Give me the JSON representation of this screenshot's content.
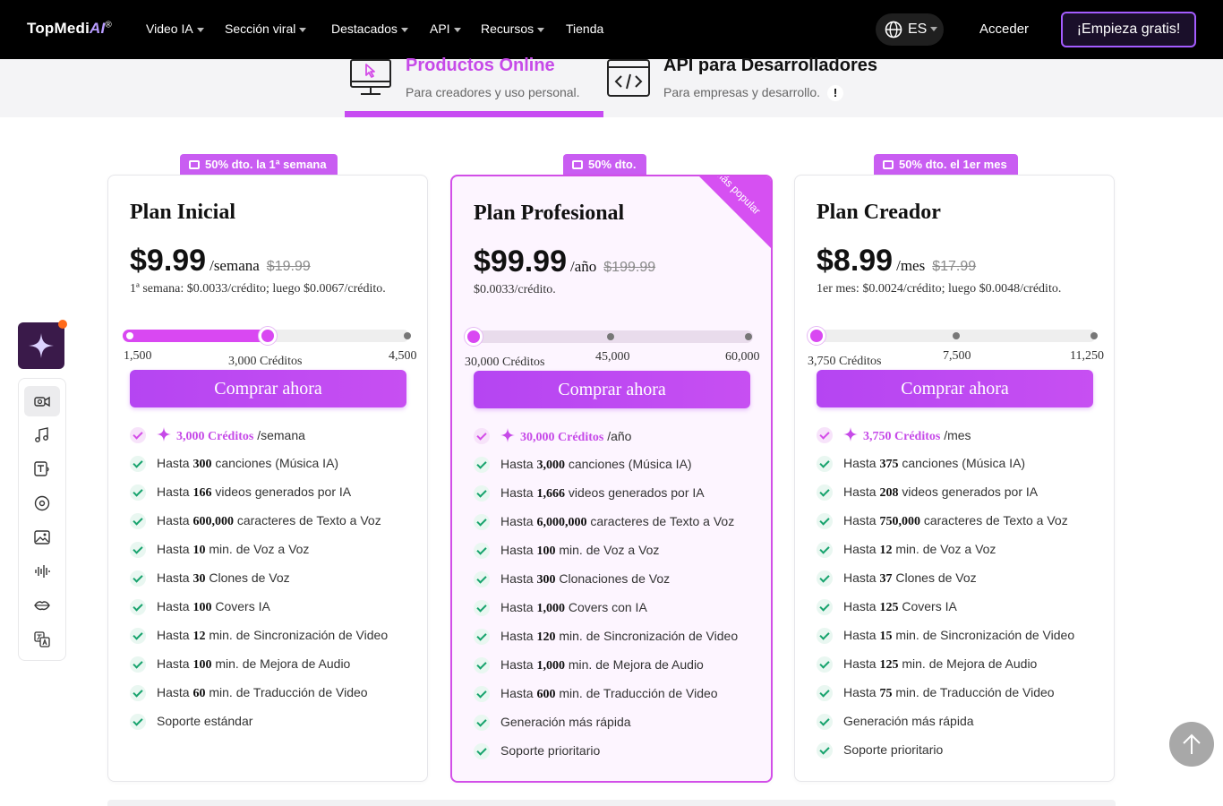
{
  "nav": {
    "logo_top": "TopMedi",
    "logo_ai": "AI",
    "logo_reg": "®",
    "items": [
      {
        "label": "Video IA"
      },
      {
        "label": "Sección viral"
      },
      {
        "label": "Destacados"
      },
      {
        "label": "API"
      },
      {
        "label": "Recursos"
      },
      {
        "label": "Tienda"
      }
    ],
    "lang": "ES",
    "login": "Acceder",
    "cta": "¡Empieza gratis!"
  },
  "product_tabs": [
    {
      "title": "Productos Online",
      "subtitle": "Para creadores y uso personal."
    },
    {
      "title": "API para Desarrolladores",
      "subtitle": "Para empresas y desarrollo.",
      "badge": "!"
    }
  ],
  "colors": {
    "accent": "#c74bf2",
    "check": "#17a36d"
  },
  "plans": [
    {
      "badge": "50% dto. la 1ª semana",
      "name": "Plan Inicial",
      "price": "$9.99",
      "period": "/semana",
      "old_price": "$19.99",
      "note": "1ª semana: $0.0033/crédito; luego $0.0067/crédito.",
      "slider": {
        "min": "1,500",
        "selected": "3,000 Créditos",
        "max": "4,500",
        "position": 0.5
      },
      "buy": "Comprar ahora",
      "credits": {
        "amount": "3,000 Créditos",
        "per": "/semana"
      },
      "features": [
        {
          "pre": "Hasta ",
          "num": "300",
          "post": " canciones (Música IA)"
        },
        {
          "pre": "Hasta ",
          "num": "166",
          "post": " videos generados por IA"
        },
        {
          "pre": "Hasta ",
          "num": "600,000",
          "post": " caracteres de Texto a Voz"
        },
        {
          "pre": "Hasta ",
          "num": "10",
          "post": " min. de Voz a Voz"
        },
        {
          "pre": "Hasta ",
          "num": "30",
          "post": " Clones de Voz"
        },
        {
          "pre": "Hasta ",
          "num": "100",
          "post": " Covers IA"
        },
        {
          "pre": "Hasta ",
          "num": "12",
          "post": " min. de Sincronización de Video"
        },
        {
          "pre": "Hasta ",
          "num": "100",
          "post": " min. de Mejora de Audio"
        },
        {
          "pre": "Hasta ",
          "num": "60",
          "post": " min. de Traducción de Video"
        },
        {
          "pre": "Soporte estándar",
          "num": "",
          "post": ""
        }
      ]
    },
    {
      "badge": "50% dto.",
      "ribbon": "Más popular",
      "name": "Plan Profesional",
      "price": "$99.99",
      "period": "/año",
      "old_price": "$199.99",
      "note": "$0.0033/crédito.",
      "slider": {
        "min": "30,000 Créditos",
        "mid": "45,000",
        "max": "60,000",
        "position": 0
      },
      "buy": "Comprar ahora",
      "credits": {
        "amount": "30,000 Créditos",
        "per": "/año"
      },
      "features": [
        {
          "pre": "Hasta ",
          "num": "3,000",
          "post": " canciones (Música IA)"
        },
        {
          "pre": "Hasta ",
          "num": "1,666",
          "post": " videos generados por IA"
        },
        {
          "pre": "Hasta ",
          "num": "6,000,000",
          "post": " caracteres de Texto a Voz"
        },
        {
          "pre": "Hasta ",
          "num": "100",
          "post": " min. de Voz a Voz"
        },
        {
          "pre": "Hasta ",
          "num": "300",
          "post": " Clonaciones de Voz"
        },
        {
          "pre": "Hasta ",
          "num": "1,000",
          "post": " Covers con IA"
        },
        {
          "pre": "Hasta ",
          "num": "120",
          "post": " min. de Sincronización de Video"
        },
        {
          "pre": "Hasta ",
          "num": "1,000",
          "post": " min. de Mejora de Audio"
        },
        {
          "pre": "Hasta ",
          "num": "600",
          "post": " min. de Traducción de Video"
        },
        {
          "pre": "Generación más rápida",
          "num": "",
          "post": ""
        },
        {
          "pre": "Soporte prioritario",
          "num": "",
          "post": ""
        }
      ]
    },
    {
      "badge": "50% dto. el 1er mes",
      "name": "Plan Creador",
      "price": "$8.99",
      "period": "/mes",
      "old_price": "$17.99",
      "note": "1er mes: $0.0024/crédito; luego $0.0048/crédito.",
      "slider": {
        "min": "3,750 Créditos",
        "mid": "7,500",
        "max": "11,250",
        "position": 0
      },
      "buy": "Comprar ahora",
      "credits": {
        "amount": "3,750 Créditos",
        "per": "/mes"
      },
      "features": [
        {
          "pre": "Hasta ",
          "num": "375",
          "post": " canciones (Música IA)"
        },
        {
          "pre": "Hasta ",
          "num": "208",
          "post": " videos generados por IA"
        },
        {
          "pre": "Hasta ",
          "num": "750,000",
          "post": " caracteres de Texto a Voz"
        },
        {
          "pre": "Hasta ",
          "num": "12",
          "post": " min. de Voz a Voz"
        },
        {
          "pre": "Hasta ",
          "num": "37",
          "post": " Clones de Voz"
        },
        {
          "pre": "Hasta ",
          "num": "125",
          "post": " Covers IA"
        },
        {
          "pre": "Hasta ",
          "num": "15",
          "post": " min. de Sincronización de Video"
        },
        {
          "pre": "Hasta ",
          "num": "125",
          "post": " min. de Mejora de Audio"
        },
        {
          "pre": "Hasta ",
          "num": "75",
          "post": " min. de Traducción de Video"
        },
        {
          "pre": "Generación más rápida",
          "num": "",
          "post": ""
        },
        {
          "pre": "Soporte prioritario",
          "num": "",
          "post": ""
        }
      ]
    }
  ],
  "sidebar": {
    "items": [
      {
        "icon": "video-camera-icon"
      },
      {
        "icon": "music-note-icon"
      },
      {
        "icon": "text-to-speech-icon"
      },
      {
        "icon": "disc-icon"
      },
      {
        "icon": "image-icon"
      },
      {
        "icon": "waveform-icon"
      },
      {
        "icon": "lips-icon"
      },
      {
        "icon": "translate-icon"
      }
    ]
  }
}
